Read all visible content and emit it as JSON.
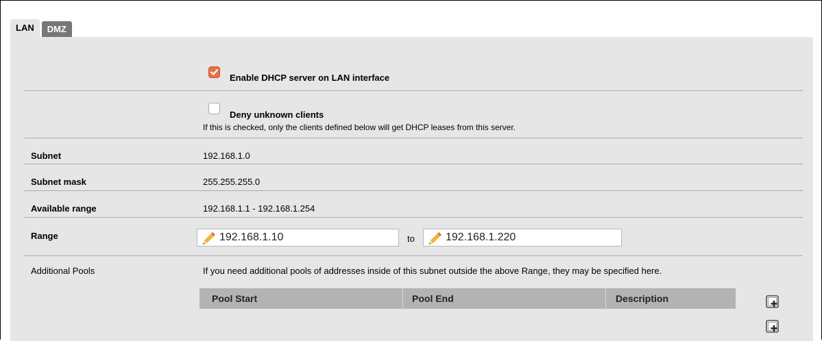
{
  "tabs": [
    {
      "label": "LAN",
      "active": true
    },
    {
      "label": "DMZ",
      "active": false
    }
  ],
  "enable_dhcp": {
    "label": "Enable DHCP server on LAN interface",
    "checked": true
  },
  "deny_unknown": {
    "label": "Deny unknown clients",
    "checked": false,
    "help": "If this is checked, only the clients defined below will get DHCP leases from this server."
  },
  "subnet": {
    "label": "Subnet",
    "value": "192.168.1.0"
  },
  "subnet_mask": {
    "label": "Subnet mask",
    "value": "255.255.255.0"
  },
  "available_range": {
    "label": "Available range",
    "value": "192.168.1.1 - 192.168.1.254"
  },
  "range": {
    "label": "Range",
    "from": "192.168.1.10",
    "to_label": "to",
    "to": "192.168.1.220"
  },
  "additional_pools": {
    "label": "Additional Pools",
    "help": "If you need additional pools of addresses inside of this subnet outside the above Range, they may be specified here.",
    "columns": [
      "Pool Start",
      "Pool End",
      "Description"
    ]
  },
  "colors": {
    "accent": "#e9704a",
    "panel": "#e6e6e6",
    "header": "#b3b3b3"
  },
  "icons": [
    "checkmark-icon",
    "pencil-icon",
    "add-row-icon"
  ]
}
